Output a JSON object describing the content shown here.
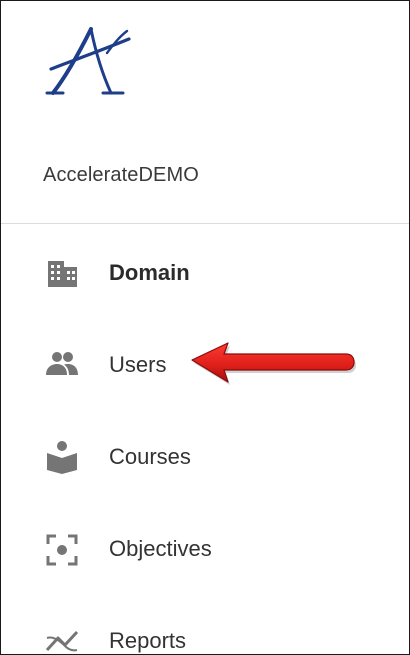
{
  "app": {
    "logo_icon": "accelerate-logo-icon",
    "organization_name": "AccelerateDEMO"
  },
  "sidebar": {
    "items": [
      {
        "label": "Domain",
        "icon": "building-icon",
        "active": true
      },
      {
        "label": "Users",
        "icon": "people-icon",
        "active": false
      },
      {
        "label": "Courses",
        "icon": "book-reader-icon",
        "active": false
      },
      {
        "label": "Objectives",
        "icon": "center-focus-icon",
        "active": false
      },
      {
        "label": "Reports",
        "icon": "trending-icon",
        "active": false
      }
    ]
  },
  "annotation": {
    "arrow_icon": "red-arrow-icon",
    "arrow_color": "#e0201b"
  },
  "colors": {
    "logo_blue": "#1f3e8a",
    "icon_gray": "#757575",
    "text": "#333333"
  }
}
